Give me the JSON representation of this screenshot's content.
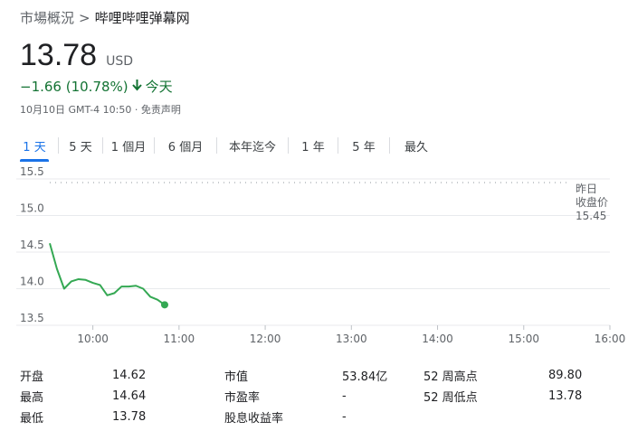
{
  "breadcrumb": {
    "root": "市場概況",
    "separator": ">",
    "current": "哔哩哔哩弹幕网"
  },
  "quote": {
    "price": "13.78",
    "currency": "USD",
    "change": "−1.66 (10.78%)",
    "change_arrow": "arrow-down-icon",
    "period": "今天",
    "timestamp": "10月10日 GMT-4 10:50 · 免责声明"
  },
  "tabs": [
    "1 天",
    "5 天",
    "1 個月",
    "6 個月",
    "本年迄今",
    "1 年",
    "5 年",
    "最久"
  ],
  "active_tab": 0,
  "colors": {
    "up_down_green": "#137333",
    "line": "#34a853",
    "accent": "#1a73e8"
  },
  "chart_data": {
    "type": "line",
    "ylim": [
      13.5,
      15.5
    ],
    "yticks": [
      "15.5",
      "15.0",
      "14.5",
      "14.0",
      "13.5"
    ],
    "xticks": [
      "10:00",
      "11:00",
      "12:00",
      "13:00",
      "14:00",
      "15:00",
      "16:00"
    ],
    "series": [
      {
        "values_x": [
          "09:30",
          "09:35",
          "09:40",
          "09:45",
          "09:50",
          "09:55",
          "10:00",
          "10:05",
          "10:10",
          "10:15",
          "10:20",
          "10:25",
          "10:30",
          "10:35",
          "10:40",
          "10:45",
          "10:50"
        ],
        "values": [
          14.62,
          14.27,
          14.0,
          14.1,
          14.13,
          14.12,
          14.08,
          14.05,
          13.91,
          13.94,
          14.03,
          14.03,
          14.04,
          14.0,
          13.89,
          13.85,
          13.78
        ]
      }
    ],
    "previous_close": {
      "label": "昨日\n收盘价",
      "value": "15.45"
    }
  },
  "stats": [
    {
      "label": "开盘",
      "value": "14.62"
    },
    {
      "label": "最高",
      "value": "14.64"
    },
    {
      "label": "最低",
      "value": "13.78"
    },
    {
      "label": "市值",
      "value": "53.84亿"
    },
    {
      "label": "市盈率",
      "value": "-"
    },
    {
      "label": "股息收益率",
      "value": "-"
    },
    {
      "label": "52 周高点",
      "value": "89.80"
    },
    {
      "label": "52 周低点",
      "value": "13.78"
    }
  ]
}
